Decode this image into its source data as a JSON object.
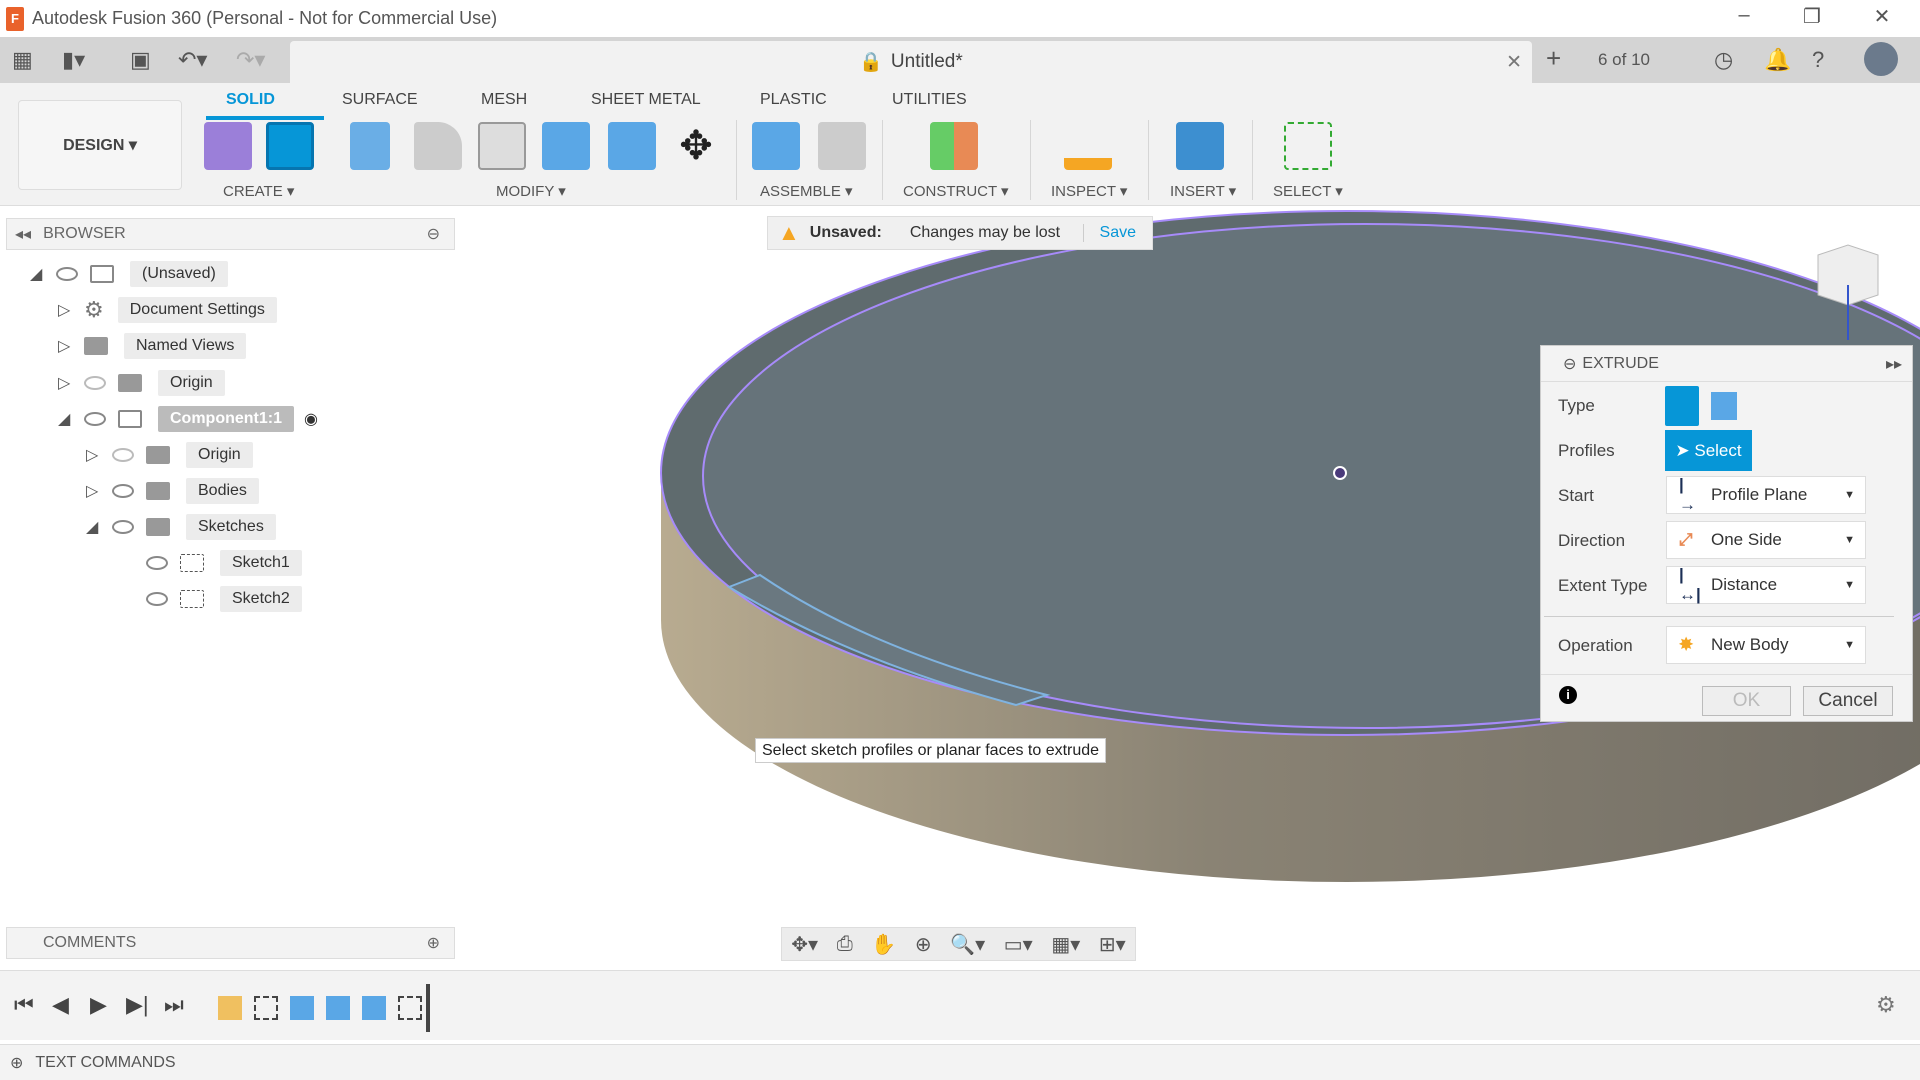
{
  "window": {
    "title": "Autodesk Fusion 360 (Personal - Not for Commercial Use)",
    "minimize": "–",
    "restore": "❐",
    "close": "✕"
  },
  "tabbar": {
    "doc_title": "Untitled*",
    "close": "✕",
    "new_tab": "+",
    "jobs": "6 of 10"
  },
  "workspace": {
    "label": "DESIGN ▾"
  },
  "tabs": [
    "SOLID",
    "SURFACE",
    "MESH",
    "SHEET METAL",
    "PLASTIC",
    "UTILITIES"
  ],
  "groups": {
    "create": "CREATE ▾",
    "modify": "MODIFY ▾",
    "assemble": "ASSEMBLE ▾",
    "construct": "CONSTRUCT ▾",
    "inspect": "INSPECT ▾",
    "insert": "INSERT ▾",
    "select": "SELECT ▾"
  },
  "browser": {
    "title": "BROWSER",
    "items": [
      {
        "label": "(Unsaved)"
      },
      {
        "label": "Document Settings"
      },
      {
        "label": "Named Views"
      },
      {
        "label": "Origin"
      },
      {
        "label": "Component1:1"
      },
      {
        "label": "Origin"
      },
      {
        "label": "Bodies"
      },
      {
        "label": "Sketches"
      },
      {
        "label": "Sketch1"
      },
      {
        "label": "Sketch2"
      }
    ]
  },
  "banner": {
    "status": "Unsaved:",
    "message": "Changes may be lost",
    "save": "Save"
  },
  "extrude": {
    "title": "EXTRUDE",
    "type_label": "Type",
    "profiles_label": "Profiles",
    "select_btn": "Select",
    "start_label": "Start",
    "start_value": "Profile Plane",
    "direction_label": "Direction",
    "direction_value": "One Side",
    "extent_label": "Extent Type",
    "extent_value": "Distance",
    "operation_label": "Operation",
    "operation_value": "New Body",
    "ok": "OK",
    "cancel": "Cancel"
  },
  "tooltip": "Select sketch profiles or planar faces to extrude",
  "comments": {
    "title": "COMMENTS"
  },
  "text_commands": "TEXT COMMANDS",
  "colors": {
    "accent": "#0696d7",
    "face": "#5f6b6e",
    "side": "#8c8576",
    "edge": "#a78bfa"
  }
}
